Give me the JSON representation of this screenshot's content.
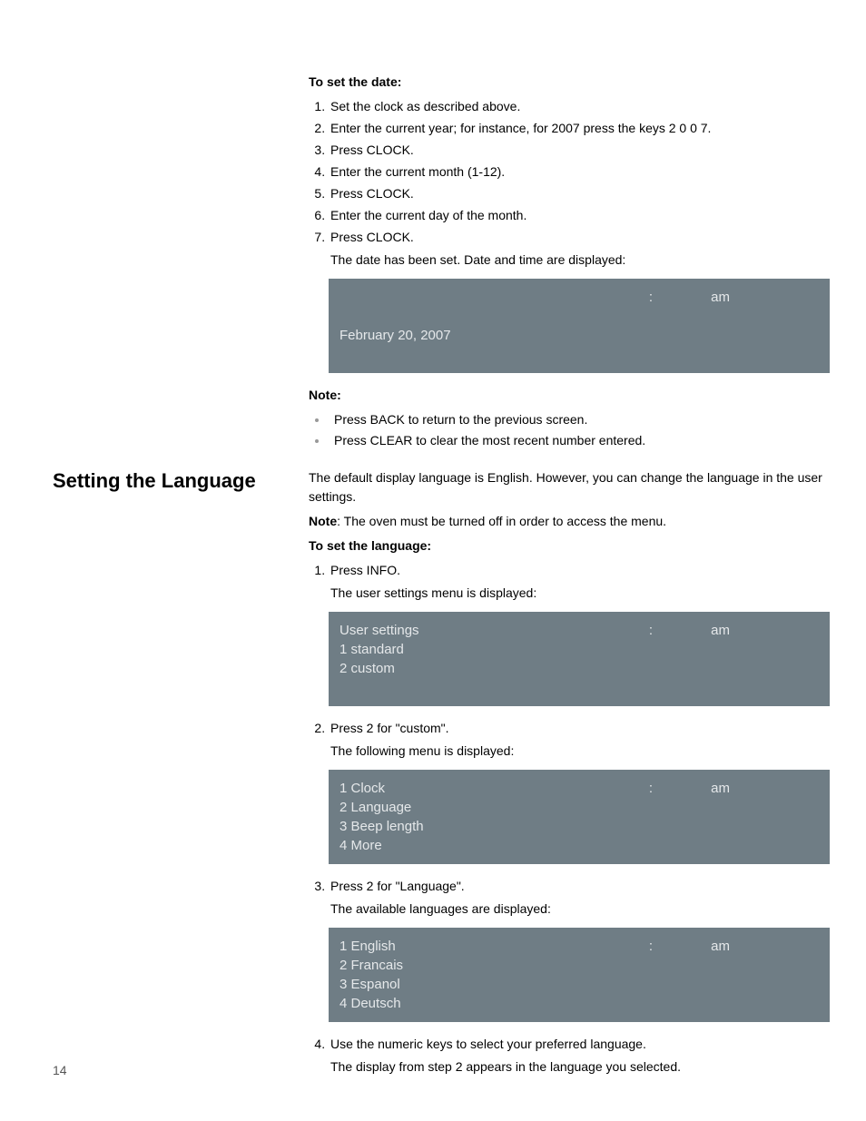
{
  "set_date": {
    "heading": "To set the date:",
    "steps": [
      "Set the clock as described above.",
      "Enter the current year; for instance, for 2007 press the keys 2 0 0 7.",
      "Press CLOCK.",
      "Enter the current month (1-12).",
      "Press CLOCK.",
      "Enter the current day of the month.",
      "Press CLOCK."
    ],
    "result_text": "The date has been set. Date and time are displayed:"
  },
  "display_date": {
    "colon": ":",
    "am": "am",
    "date_line": "February  20,  2007"
  },
  "note_section": {
    "heading": "Note:",
    "items": [
      "Press BACK to return to the previous screen.",
      "Press CLEAR to clear the most recent number entered."
    ]
  },
  "section_title": "Setting the Language",
  "lang_intro": "The default display language is English. However, you can change the language in the user settings.",
  "lang_note_label": "Note",
  "lang_note_text": ": The oven must be turned off in order to access the menu.",
  "set_lang_heading": "To set the language:",
  "step1": {
    "text": "Press INFO.",
    "sub": "The user settings menu is displayed:"
  },
  "display_user_settings": {
    "colon": ":",
    "am": "am",
    "line1": "User settings",
    "line2": "1 standard",
    "line3": "2 custom"
  },
  "step2": {
    "text": "Press 2 for \"custom\".",
    "sub": "The following menu is displayed:"
  },
  "display_custom_menu": {
    "colon": ":",
    "am": "am",
    "line1": "1 Clock",
    "line2": "2 Language",
    "line3": "3 Beep length",
    "line4": "4 More"
  },
  "step3": {
    "text": "Press 2 for \"Language\".",
    "sub": "The available languages are displayed:"
  },
  "display_languages": {
    "colon": ":",
    "am": "am",
    "line1": "1 English",
    "line2": "2 Francais",
    "line3": "3 Espanol",
    "line4": "4 Deutsch"
  },
  "step4": {
    "text": "Use the numeric keys to select your preferred language.",
    "sub": "The display from step 2 appears in the language you selected."
  },
  "page_number": "14"
}
